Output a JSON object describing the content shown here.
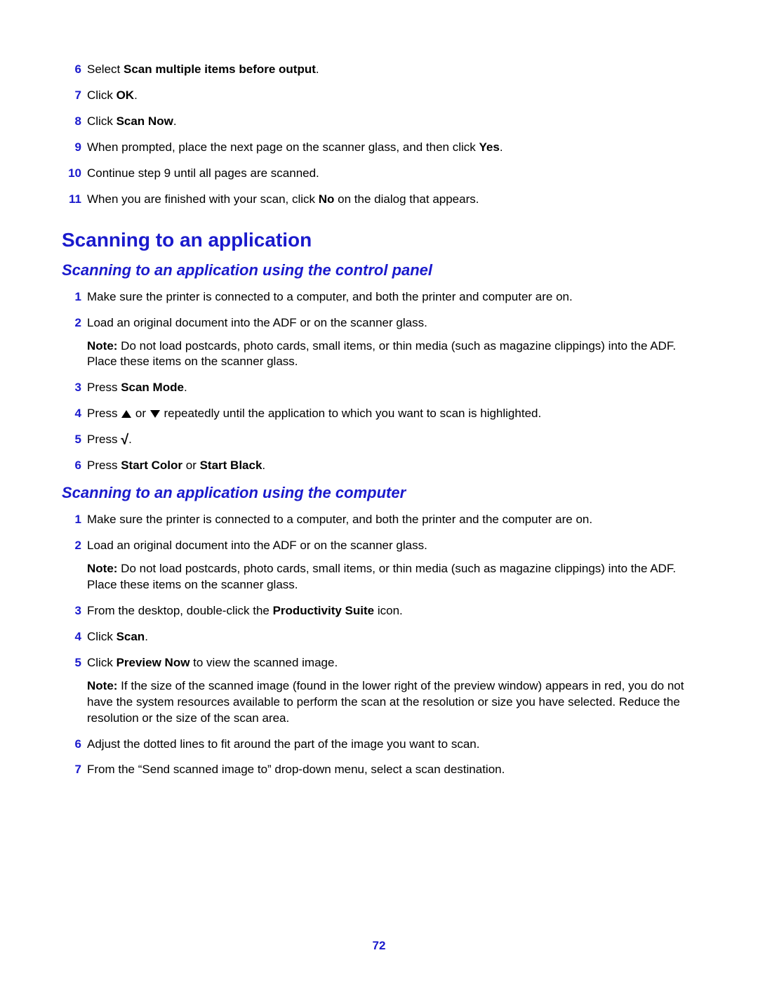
{
  "steps_top": [
    {
      "n": "6",
      "parts": [
        {
          "t": "Select "
        },
        {
          "t": "Scan multiple items before output",
          "b": true
        },
        {
          "t": "."
        }
      ]
    },
    {
      "n": "7",
      "parts": [
        {
          "t": "Click "
        },
        {
          "t": "OK",
          "b": true
        },
        {
          "t": "."
        }
      ]
    },
    {
      "n": "8",
      "parts": [
        {
          "t": "Click "
        },
        {
          "t": "Scan Now",
          "b": true
        },
        {
          "t": "."
        }
      ]
    },
    {
      "n": "9",
      "parts": [
        {
          "t": "When prompted, place the next page on the scanner glass, and then click "
        },
        {
          "t": "Yes",
          "b": true
        },
        {
          "t": "."
        }
      ]
    },
    {
      "n": "10",
      "parts": [
        {
          "t": "Continue step 9 until all pages are scanned."
        }
      ]
    },
    {
      "n": "11",
      "parts": [
        {
          "t": "When you are finished with your scan, click "
        },
        {
          "t": "No",
          "b": true
        },
        {
          "t": " on the dialog that appears."
        }
      ]
    }
  ],
  "section_title": "Scanning to an application",
  "sub1_title": "Scanning to an application using the control panel",
  "sub1_steps": [
    {
      "n": "1",
      "parts": [
        {
          "t": "Make sure the printer is connected to a computer, and both the printer and computer are on."
        }
      ]
    },
    {
      "n": "2",
      "parts": [
        {
          "t": "Load an original document into the ADF or on the scanner glass."
        }
      ],
      "note_parts": [
        {
          "t": "Note:",
          "b": true
        },
        {
          "t": " Do not load postcards, photo cards, small items, or thin media (such as magazine clippings) into the ADF. Place these items on the scanner glass."
        }
      ]
    },
    {
      "n": "3",
      "parts": [
        {
          "t": "Press "
        },
        {
          "t": "Scan Mode",
          "b": true
        },
        {
          "t": "."
        }
      ]
    },
    {
      "n": "4",
      "parts": [
        {
          "t": "Press "
        },
        {
          "icon": "tri-up"
        },
        {
          "t": " or "
        },
        {
          "icon": "tri-down"
        },
        {
          "t": " repeatedly until the application to which you want to scan is highlighted."
        }
      ]
    },
    {
      "n": "5",
      "parts": [
        {
          "t": "Press "
        },
        {
          "icon": "check"
        },
        {
          "t": "."
        }
      ]
    },
    {
      "n": "6",
      "parts": [
        {
          "t": "Press "
        },
        {
          "t": "Start Color",
          "b": true
        },
        {
          "t": " or "
        },
        {
          "t": "Start Black",
          "b": true
        },
        {
          "t": "."
        }
      ]
    }
  ],
  "sub2_title": "Scanning to an application using the computer",
  "sub2_steps": [
    {
      "n": "1",
      "parts": [
        {
          "t": "Make sure the printer is connected to a computer, and both the printer and the computer are on."
        }
      ]
    },
    {
      "n": "2",
      "parts": [
        {
          "t": "Load an original document into the ADF or on the scanner glass."
        }
      ],
      "note_parts": [
        {
          "t": "Note:",
          "b": true
        },
        {
          "t": " Do not load postcards, photo cards, small items, or thin media (such as magazine clippings) into the ADF. Place these items on the scanner glass."
        }
      ]
    },
    {
      "n": "3",
      "parts": [
        {
          "t": "From the desktop, double-click the "
        },
        {
          "t": "Productivity Suite",
          "b": true
        },
        {
          "t": " icon."
        }
      ]
    },
    {
      "n": "4",
      "parts": [
        {
          "t": "Click "
        },
        {
          "t": "Scan",
          "b": true
        },
        {
          "t": "."
        }
      ]
    },
    {
      "n": "5",
      "parts": [
        {
          "t": "Click "
        },
        {
          "t": "Preview Now",
          "b": true
        },
        {
          "t": " to view the scanned image."
        }
      ],
      "note_parts": [
        {
          "t": "Note:",
          "b": true
        },
        {
          "t": " If the size of the scanned image (found in the lower right of the preview window) appears in red, you do not have the system resources available to perform the scan at the resolution or size you have selected. Reduce the resolution or the size of the scan area."
        }
      ]
    },
    {
      "n": "6",
      "parts": [
        {
          "t": "Adjust the dotted lines to fit around the part of the image you want to scan."
        }
      ]
    },
    {
      "n": "7",
      "parts": [
        {
          "t": "From the “Send scanned image to” drop-down menu, select a scan destination."
        }
      ]
    }
  ],
  "page_number": "72"
}
